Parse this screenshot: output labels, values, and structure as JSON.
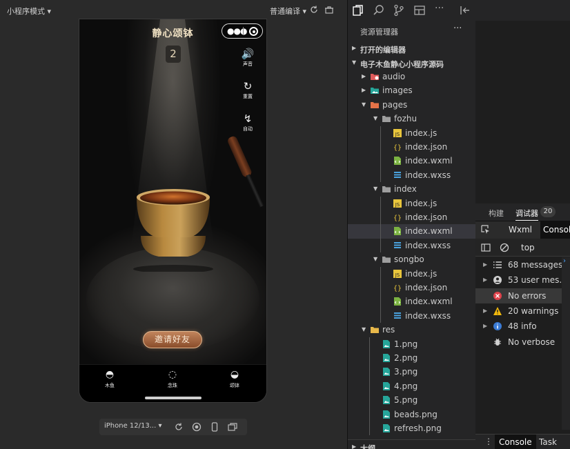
{
  "simulator": {
    "mode_label": "小程序模式 ▾",
    "compile_label": "普通编译 ▾",
    "device_label": "iPhone 12/13... ▾"
  },
  "miniapp": {
    "title": "静心颂钵",
    "counter": "2",
    "side_buttons": [
      {
        "glyph": "🔊",
        "label": "声音"
      },
      {
        "glyph": "↻",
        "label": "重置"
      },
      {
        "glyph": "↯",
        "label": "自动"
      }
    ],
    "invite_label": "邀请好友",
    "tabs": [
      {
        "glyph": "◓",
        "label": "木鱼"
      },
      {
        "glyph": "◌",
        "label": "念珠"
      },
      {
        "glyph": "◒",
        "label": "颂钵"
      }
    ]
  },
  "explorer": {
    "title": "资源管理器",
    "more": "···",
    "open_editors": "打开的编辑器",
    "project": "电子木鱼静心小程序源码",
    "outline": "大纲",
    "tree": [
      {
        "name": "audio",
        "type": "folder-audio",
        "depth": 1,
        "arrow": "▶"
      },
      {
        "name": "images",
        "type": "folder-images",
        "depth": 1,
        "arrow": "▶"
      },
      {
        "name": "pages",
        "type": "folder-pages",
        "depth": 1,
        "arrow": "▼"
      },
      {
        "name": "fozhu",
        "type": "folder",
        "depth": 2,
        "arrow": "▼"
      },
      {
        "name": "index.js",
        "type": "js",
        "depth": 3
      },
      {
        "name": "index.json",
        "type": "json",
        "depth": 3
      },
      {
        "name": "index.wxml",
        "type": "wxml",
        "depth": 3
      },
      {
        "name": "index.wxss",
        "type": "wxss",
        "depth": 3
      },
      {
        "name": "index",
        "type": "folder",
        "depth": 2,
        "arrow": "▼"
      },
      {
        "name": "index.js",
        "type": "js",
        "depth": 3
      },
      {
        "name": "index.json",
        "type": "json",
        "depth": 3
      },
      {
        "name": "index.wxml",
        "type": "wxml",
        "depth": 3,
        "selected": true
      },
      {
        "name": "index.wxss",
        "type": "wxss",
        "depth": 3
      },
      {
        "name": "songbo",
        "type": "folder",
        "depth": 2,
        "arrow": "▼"
      },
      {
        "name": "index.js",
        "type": "js",
        "depth": 3
      },
      {
        "name": "index.json",
        "type": "json",
        "depth": 3
      },
      {
        "name": "index.wxml",
        "type": "wxml",
        "depth": 3
      },
      {
        "name": "index.wxss",
        "type": "wxss",
        "depth": 3
      },
      {
        "name": "res",
        "type": "folder-res",
        "depth": 1,
        "arrow": "▼"
      },
      {
        "name": "1.png",
        "type": "png",
        "depth": 2
      },
      {
        "name": "2.png",
        "type": "png",
        "depth": 2
      },
      {
        "name": "3.png",
        "type": "png",
        "depth": 2
      },
      {
        "name": "4.png",
        "type": "png",
        "depth": 2
      },
      {
        "name": "5.png",
        "type": "png",
        "depth": 2
      },
      {
        "name": "beads.png",
        "type": "png",
        "depth": 2
      },
      {
        "name": "refresh.png",
        "type": "png",
        "depth": 2
      }
    ]
  },
  "debugger": {
    "tabs": [
      {
        "label": "构建"
      },
      {
        "label": "调试器",
        "active": true
      }
    ],
    "badge": "20",
    "subtabs": [
      {
        "label": "Wxml"
      },
      {
        "label": "Console",
        "active": true
      }
    ],
    "context": "top",
    "console_items": [
      {
        "label": "68 messages",
        "icon": "list-icon",
        "arrow": "▶"
      },
      {
        "label": "53 user mes...",
        "icon": "user-icon",
        "arrow": "▶"
      },
      {
        "label": "No errors",
        "icon": "error-icon",
        "arrow": "",
        "selected": true
      },
      {
        "label": "20 warnings",
        "icon": "warning-icon",
        "arrow": "▶"
      },
      {
        "label": "48 info",
        "icon": "info-icon",
        "arrow": "▶"
      },
      {
        "label": "No verbose",
        "icon": "verbose-icon",
        "arrow": ""
      }
    ],
    "drawer_tabs": [
      {
        "label": "Console",
        "active": true
      },
      {
        "label": "Task"
      }
    ]
  },
  "colors": {
    "js": "#e8c53c",
    "json": "#e8c53c",
    "wxml": "#7cb342",
    "wxss": "#4aa3df",
    "png": "#26a69a",
    "folder": "#c5a06a"
  }
}
